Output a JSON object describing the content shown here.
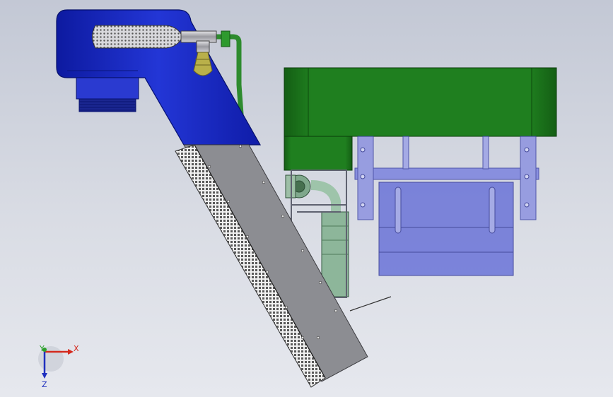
{
  "axis_triad": {
    "x_label": "X",
    "y_label": "Y",
    "z_label": "Z",
    "x_color": "#d42a1e",
    "y_color": "#2ca02c",
    "z_color": "#1f2fbf"
  },
  "colors": {
    "background_top": "#c3c8d5",
    "background_bottom": "#e6e8ee",
    "hopper_blue": "#1b2fc8",
    "tank_green": "#1d7a1d",
    "chute_gray": "#8c8d92",
    "frame_blue_translucent": "#6b72d6",
    "pipe_green": "#3a8f3a",
    "pump_green": "#8fb59a"
  }
}
